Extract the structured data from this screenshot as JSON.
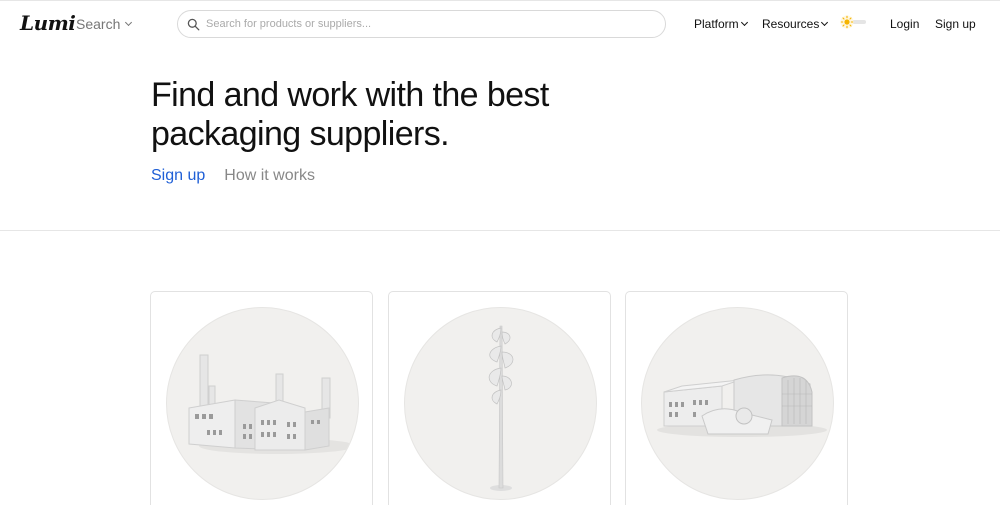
{
  "header": {
    "logo": "Lumi",
    "search_menu_label": "Search",
    "search_placeholder": "Search for products or suppliers...",
    "nav": {
      "platform": "Platform",
      "resources": "Resources",
      "login": "Login",
      "signup": "Sign up"
    },
    "theme_icon": "sun-icon",
    "accent_sun": "#f5b400"
  },
  "hero": {
    "title": "Find and work with the best packaging suppliers.",
    "primary_link": "Sign up",
    "secondary_link": "How it works",
    "accent": "#1f5fd6"
  },
  "cards": [
    {
      "illustration": "factory-illustration"
    },
    {
      "illustration": "tree-illustration"
    },
    {
      "illustration": "paper-mill-illustration"
    }
  ]
}
